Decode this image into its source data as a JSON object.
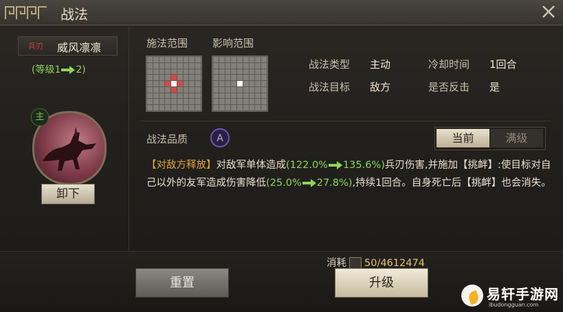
{
  "window": {
    "title": "战法",
    "close_icon": "close-icon",
    "title_ornament_icon": "fret-ornament-icon"
  },
  "skill": {
    "tag": "兵刃",
    "name": "威风凛凛",
    "level_text_prefix": "(等级1",
    "level_text_suffix": "2)",
    "equip_badge": "主",
    "unequip_label": "卸下"
  },
  "ranges": {
    "cast_label": "施法范围",
    "effect_label": "影响范围",
    "cast_grid": {
      "size": 9,
      "white": [
        [
          4,
          4
        ]
      ],
      "red": [
        [
          3,
          4
        ],
        [
          5,
          4
        ],
        [
          4,
          3
        ],
        [
          4,
          5
        ]
      ]
    },
    "effect_grid": {
      "size": 9,
      "white": [
        [
          4,
          4
        ]
      ],
      "red": []
    }
  },
  "info": {
    "type_label": "战法类型",
    "type_value": "主动",
    "cooldown_label": "冷却时间",
    "cooldown_value": "1回合",
    "target_label": "战法目标",
    "target_value": "敌方",
    "counter_label": "是否反击",
    "counter_value": "是"
  },
  "quality": {
    "label": "战法品质",
    "grade": "A"
  },
  "tabs": {
    "current": "当前",
    "max": "满级"
  },
  "description": {
    "tag": "【对敌方释放】",
    "p1": "对敌军单体造成",
    "v1_open": "(122.0%",
    "v1_close": "135.6%)",
    "p2": "兵刃伤害,并施加【挑衅】:使目标对自己以外的友军造成伤害降低",
    "v2_open": "(25.0%",
    "v2_close": "27.8%)",
    "p3": ",持续1回合。自身死亡后【挑衅】也会消失。"
  },
  "footer": {
    "cost_label": "消耗",
    "cost_value": "50/4612474",
    "cost_icon": "merit-token-icon",
    "reset_label": "重置",
    "upgrade_label": "升级"
  },
  "watermark": {
    "text": "易轩手游网",
    "sub": "ibudongguan.com"
  },
  "colors": {
    "accent_green": "#8fd45a",
    "accent_orange": "#e0a43a",
    "weapon_red": "#d04040"
  }
}
